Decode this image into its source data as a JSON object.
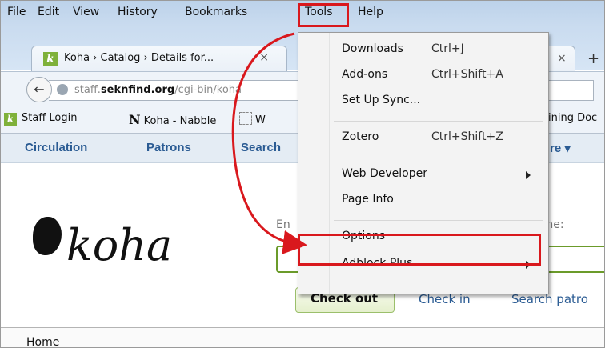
{
  "menubar": {
    "items": [
      {
        "key": "file",
        "label": "File"
      },
      {
        "key": "edit",
        "label": "Edit"
      },
      {
        "key": "view",
        "label": "View"
      },
      {
        "key": "history",
        "label": "History"
      },
      {
        "key": "bookmarks",
        "label": "Bookmarks"
      },
      {
        "key": "tools",
        "label": "Tools"
      },
      {
        "key": "help",
        "label": "Help"
      }
    ]
  },
  "tabs": {
    "active": {
      "label": "Koha › Catalog › Details for...",
      "close": "×"
    },
    "other": {
      "close": "×"
    },
    "new_tab": "+"
  },
  "navbar": {
    "back": "←",
    "url_prefix": "staff.",
    "url_domain": "seknfind.org",
    "url_rest": "/cgi-bin/koha"
  },
  "bookmarks": {
    "items": [
      {
        "label": "Staff Login"
      },
      {
        "label": "Koha - Nabble"
      },
      {
        "label": "W"
      },
      {
        "label": "ining Doc"
      }
    ]
  },
  "koha_nav": {
    "items": [
      "Circulation",
      "Patrons",
      "Search",
      "re ▾"
    ]
  },
  "koha": {
    "logo": "koha",
    "entry_label": "En",
    "name_label": "ame:",
    "checkout": "Check out",
    "checkin": "Check in",
    "search_patrons": "Search patro",
    "breadcrumb": "Home"
  },
  "tools_menu": {
    "items": [
      {
        "label": "Downloads",
        "shortcut": "Ctrl+J"
      },
      {
        "label": "Add-ons",
        "shortcut": "Ctrl+Shift+A"
      },
      {
        "label": "Set Up Sync...",
        "shortcut": ""
      },
      {
        "label": "Zotero",
        "shortcut": "Ctrl+Shift+Z"
      },
      {
        "label": "Web Developer",
        "shortcut": "",
        "submenu": true
      },
      {
        "label": "Page Info",
        "shortcut": ""
      },
      {
        "label": "Options",
        "shortcut": ""
      },
      {
        "label": "Adblock Plus",
        "shortcut": "",
        "submenu": true
      }
    ]
  },
  "colors": {
    "highlight_red": "#d9181d",
    "koha_green": "#7fb13a",
    "link_blue": "#2a5b93"
  }
}
